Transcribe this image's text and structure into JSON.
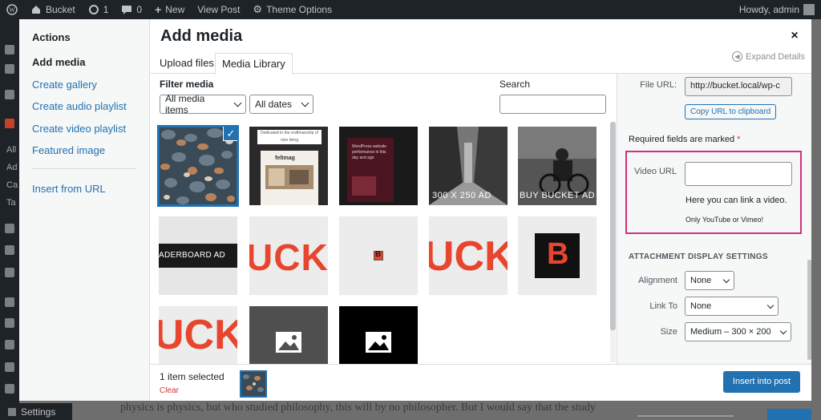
{
  "adminbar": {
    "site_name": "Bucket",
    "updates_count": "1",
    "comments_count": "0",
    "new_label": "New",
    "view_post_label": "View Post",
    "theme_options_label": "Theme Options",
    "howdy_label": "Howdy, admin"
  },
  "admin_menu": {
    "visible_fragments": [
      "All",
      "Ad",
      "Ca",
      "Ta"
    ],
    "settings_label": "Settings"
  },
  "background_text": "physics is physics, but who studied philosophy, this will by no philosopher. But I would say that the study",
  "media_frame": {
    "actions_heading": "Actions",
    "menu_items": [
      {
        "label": "Add media",
        "active": true
      },
      {
        "label": "Create gallery"
      },
      {
        "label": "Create audio playlist"
      },
      {
        "label": "Create video playlist"
      },
      {
        "label": "Featured image"
      }
    ],
    "insert_from_url": "Insert from URL",
    "title": "Add media",
    "close_glyph": "×",
    "tabs": [
      {
        "label": "Upload files"
      },
      {
        "label": "Media Library",
        "active": true
      }
    ],
    "expand_details": "Expand Details",
    "filter_label": "Filter media",
    "filter_type": "All media items",
    "filter_date": "All dates",
    "search_label": "Search",
    "search_value": ""
  },
  "attachments": [
    {
      "kind": "photo",
      "name": "pebbles",
      "selected": true
    },
    {
      "kind": "feltmag",
      "tagline": "Dedicated to the craftmanship of nice living",
      "brand": "feltmag"
    },
    {
      "kind": "dark-post",
      "text": "WordPress website performance in this day and age"
    },
    {
      "kind": "ad",
      "text": "300 X 250 AD"
    },
    {
      "kind": "ad",
      "text": "BUY BUCKET AD"
    },
    {
      "kind": "leaderboard",
      "text": "ADERBOARD AD"
    },
    {
      "kind": "logo-crop",
      "text": "UCKE"
    },
    {
      "kind": "favicon",
      "text": "B"
    },
    {
      "kind": "logo-crop-2",
      "text": "UCKI"
    },
    {
      "kind": "b-logo",
      "text": "B"
    },
    {
      "kind": "logo-crop-3",
      "text": "UCKI"
    },
    {
      "kind": "placeholder-gray"
    },
    {
      "kind": "placeholder-black"
    }
  ],
  "sidebar": {
    "file_url_label": "File URL:",
    "file_url_value": "http://bucket.local/wp-c",
    "copy_button": "Copy URL to clipboard",
    "required_text": "Required fields are marked",
    "required_star": "*",
    "video_url_label": "Video URL",
    "video_url_value": "",
    "video_help": "Here you can link a video.",
    "video_note": "Only YouTube or Vimeo!",
    "display_settings_heading": "ATTACHMENT DISPLAY SETTINGS",
    "alignment_label": "Alignment",
    "alignment_value": "None",
    "link_to_label": "Link To",
    "link_to_value": "None",
    "size_label": "Size",
    "size_value": "Medium – 300 × 200"
  },
  "footer": {
    "selection_count": "1 item selected",
    "clear_label": "Clear",
    "insert_button": "Insert into post"
  },
  "colors": {
    "accent": "#2271b1",
    "highlight_box": "#d1327c",
    "danger": "#d63638",
    "logo_red": "#e8452e"
  }
}
